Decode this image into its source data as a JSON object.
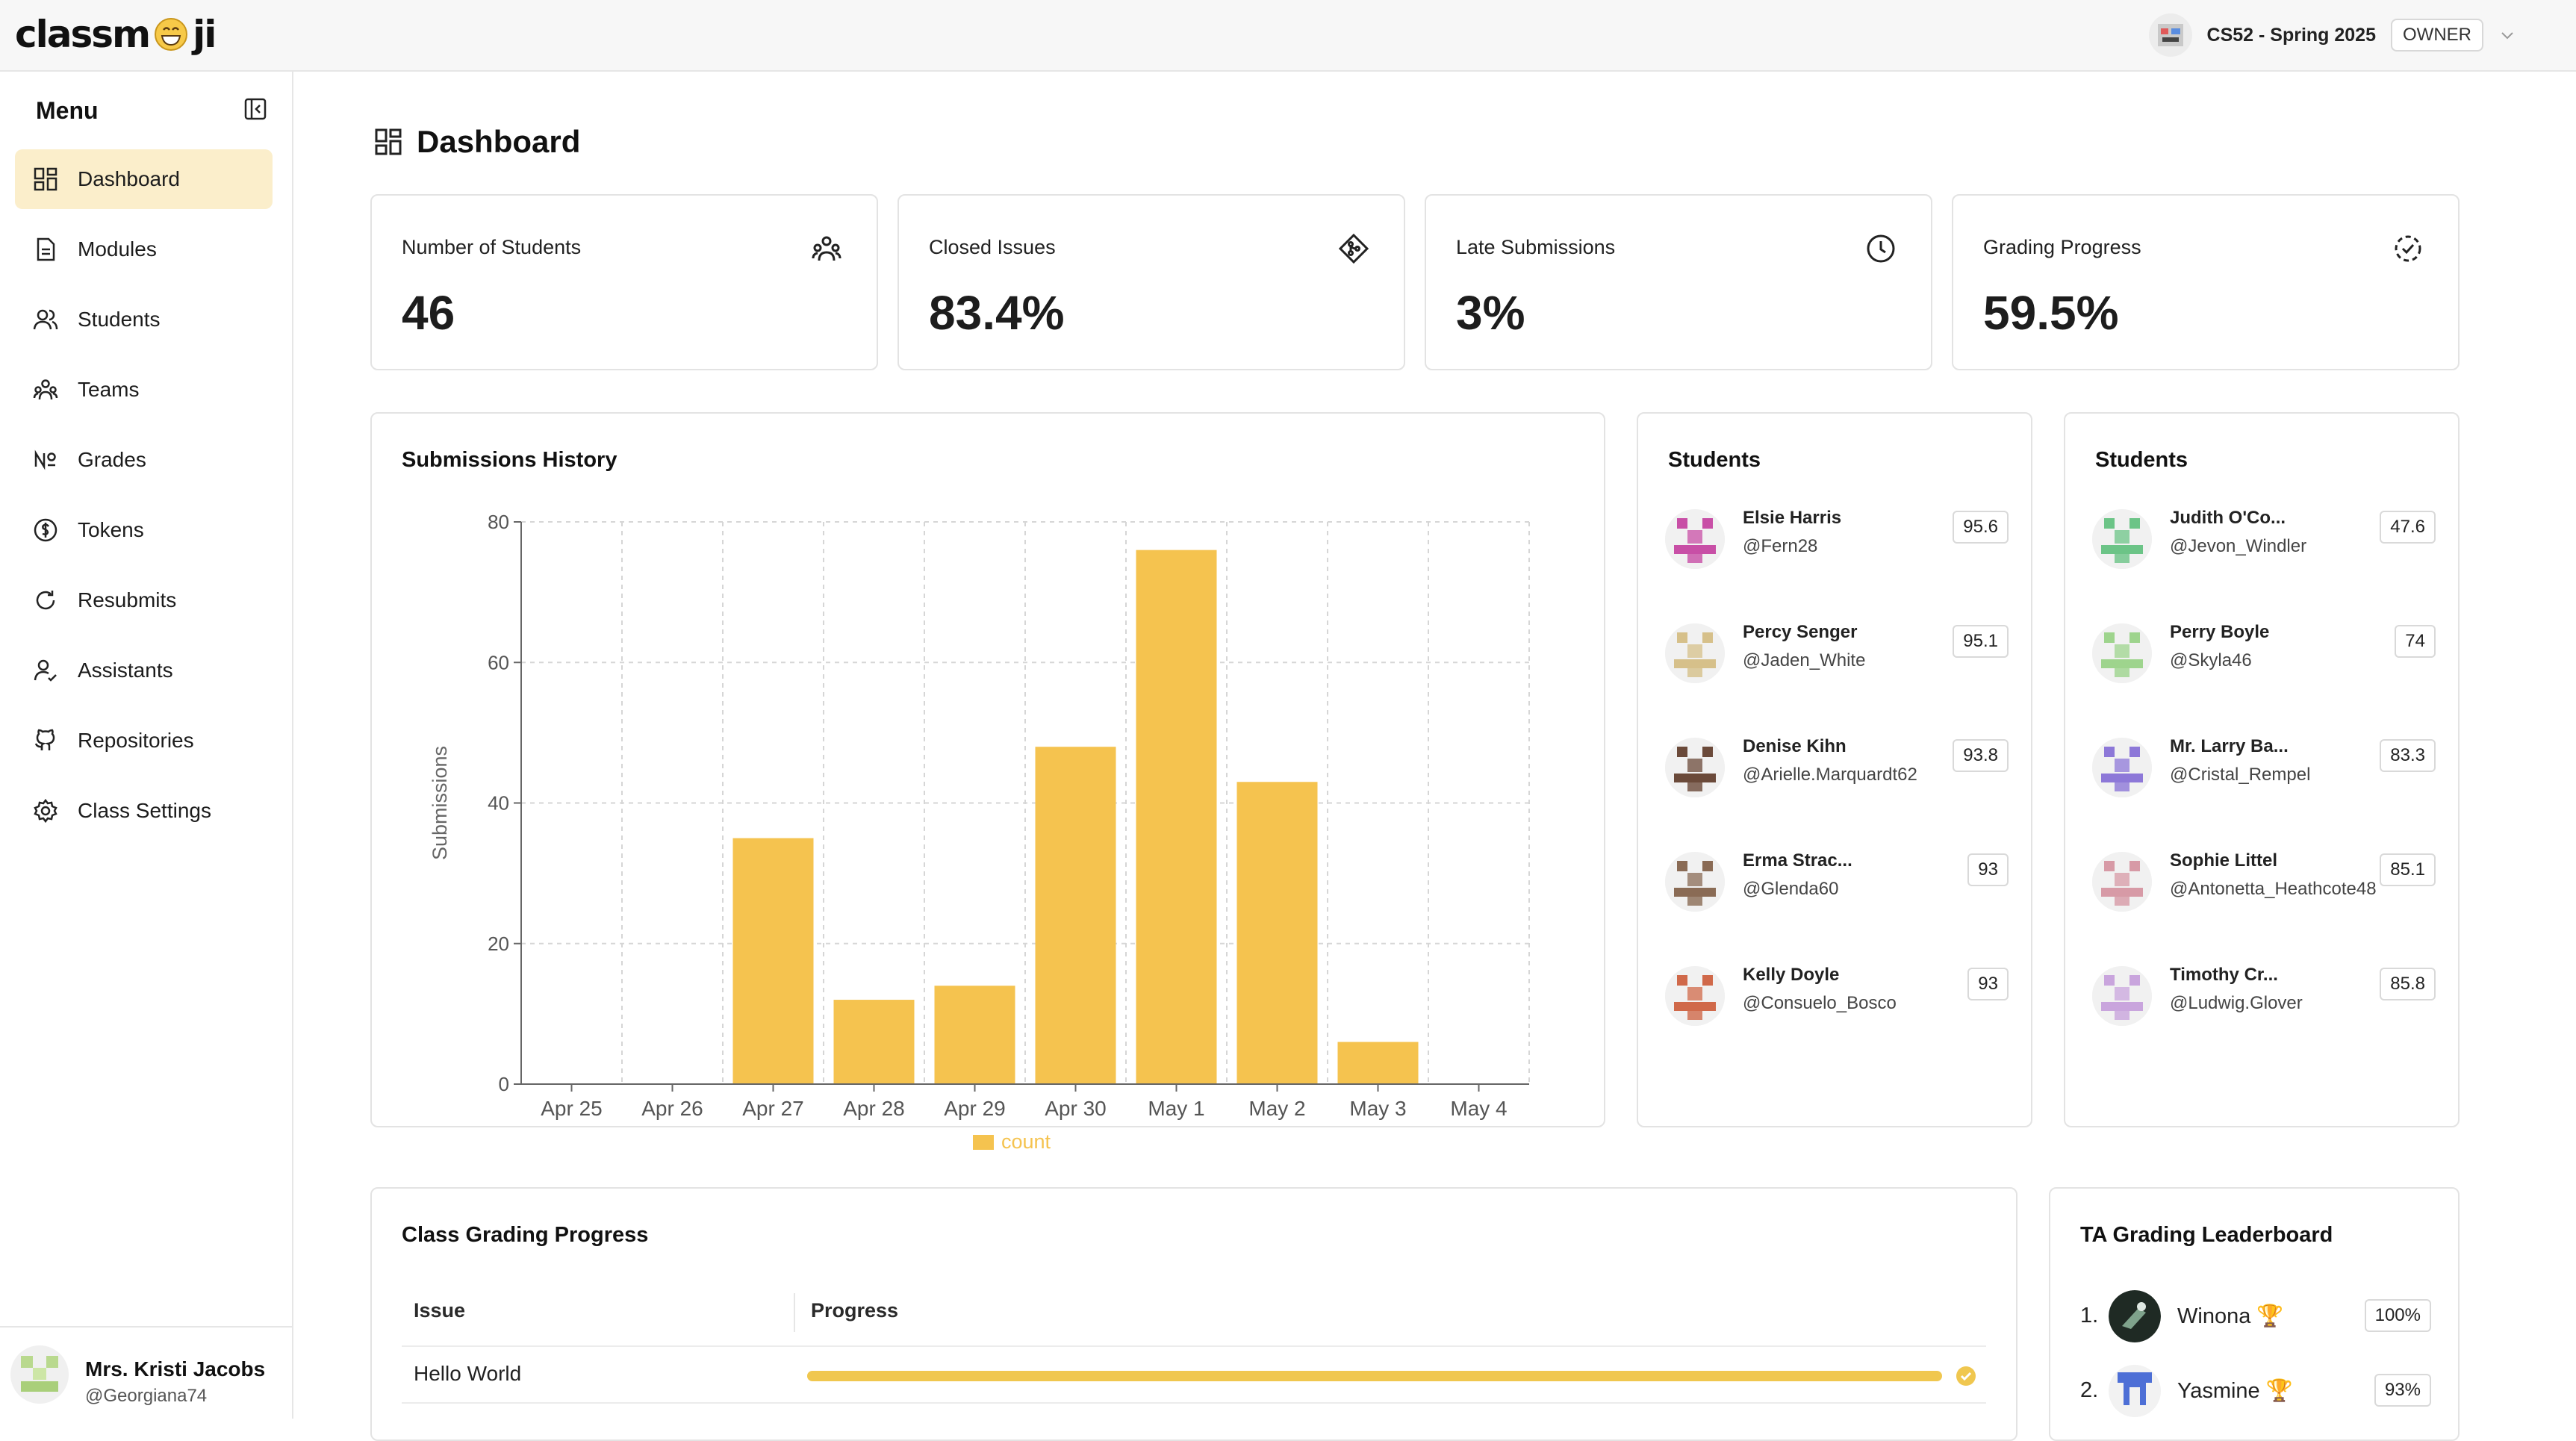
{
  "header": {
    "logo_left": "classm",
    "logo_right": "ji",
    "course_name": "CS52 - Spring 2025",
    "role": "OWNER"
  },
  "sidebar": {
    "title": "Menu",
    "items": [
      {
        "label": "Dashboard",
        "icon": "dashboard-icon",
        "active": true
      },
      {
        "label": "Modules",
        "icon": "document-icon"
      },
      {
        "label": "Students",
        "icon": "users-icon"
      },
      {
        "label": "Teams",
        "icon": "team-icon"
      },
      {
        "label": "Grades",
        "icon": "numero-icon"
      },
      {
        "label": "Tokens",
        "icon": "dollar-coin-icon"
      },
      {
        "label": "Resubmits",
        "icon": "refresh-icon"
      },
      {
        "label": "Assistants",
        "icon": "user-check-icon"
      },
      {
        "label": "Repositories",
        "icon": "github-icon"
      },
      {
        "label": "Class Settings",
        "icon": "gear-icon"
      }
    ],
    "user": {
      "name": "Mrs. Kristi Jacobs",
      "handle": "@Georgiana74"
    }
  },
  "page": {
    "title": "Dashboard"
  },
  "stats": [
    {
      "label": "Number of Students",
      "value": "46",
      "icon": "team-icon"
    },
    {
      "label": "Closed Issues",
      "value": "83.4%",
      "icon": "git-merge-icon"
    },
    {
      "label": "Late Submissions",
      "value": "3%",
      "icon": "clock-icon"
    },
    {
      "label": "Grading Progress",
      "value": "59.5%",
      "icon": "dashed-check-circle-icon"
    }
  ],
  "submissions": {
    "title": "Submissions History"
  },
  "chart_data": {
    "type": "bar",
    "categories": [
      "Apr 25",
      "Apr 26",
      "Apr 27",
      "Apr 28",
      "Apr 29",
      "Apr 30",
      "May 1",
      "May 2",
      "May 3",
      "May 4"
    ],
    "series": [
      {
        "name": "count",
        "values": [
          0,
          0,
          35,
          12,
          14,
          48,
          76,
          43,
          6,
          0
        ]
      }
    ],
    "ylabel": "Submissions",
    "ylim": [
      0,
      80
    ],
    "yticks": [
      0,
      20,
      40,
      60,
      80
    ],
    "grid": true,
    "legend": "bottom-center",
    "color": "#f5c34f"
  },
  "students_left": {
    "title": "Students",
    "items": [
      {
        "name": "Elsie Harris",
        "handle": "@Fern28",
        "grade": "95.6",
        "color": "#c84fa6"
      },
      {
        "name": "Percy Senger",
        "handle": "@Jaden_White",
        "grade": "95.1",
        "color": "#d6c08a"
      },
      {
        "name": "Denise Kihn",
        "handle": "@Arielle.Marquardt62",
        "grade": "93.8",
        "color": "#6b4a3a"
      },
      {
        "name": "Erma Strac...",
        "handle": "@Glenda60",
        "grade": "93",
        "color": "#8a6b55"
      },
      {
        "name": "Kelly Doyle",
        "handle": "@Consuelo_Bosco",
        "grade": "93",
        "color": "#d0694a"
      }
    ]
  },
  "students_right": {
    "title": "Students",
    "items": [
      {
        "name": "Judith O'Co...",
        "handle": "@Jevon_Windler",
        "grade": "47.6",
        "color": "#6cc487"
      },
      {
        "name": "Perry Boyle",
        "handle": "@Skyla46",
        "grade": "74",
        "color": "#9ed48d"
      },
      {
        "name": "Mr. Larry Ba...",
        "handle": "@Cristal_Rempel",
        "grade": "83.3",
        "color": "#8d78d8"
      },
      {
        "name": "Sophie Littel",
        "handle": "@Antonetta_Heathcote48",
        "grade": "85.1",
        "color": "#d79aa6"
      },
      {
        "name": "Timothy Cr...",
        "handle": "@Ludwig.Glover",
        "grade": "85.8",
        "color": "#c9a5dd"
      }
    ]
  },
  "grading": {
    "title": "Class Grading Progress",
    "col_issue": "Issue",
    "col_progress": "Progress",
    "rows": [
      {
        "issue": "Hello World",
        "progress": 1.0
      }
    ]
  },
  "leaderboard": {
    "title": "TA Grading Leaderboard",
    "items": [
      {
        "rank": "1.",
        "name": "Winona 🏆",
        "percent": "100%"
      },
      {
        "rank": "2.",
        "name": "Yasmine 🏆",
        "percent": "93%"
      }
    ]
  }
}
